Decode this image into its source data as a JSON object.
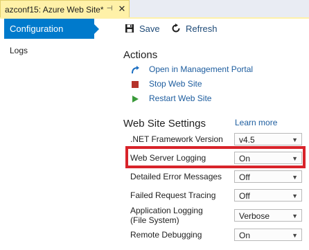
{
  "tab": {
    "title": "azconf15: Azure Web Site*",
    "pin_glyph": "⊣",
    "close_glyph": "✕"
  },
  "nav": {
    "items": [
      {
        "label": "Configuration",
        "active": true
      },
      {
        "label": "Logs",
        "active": false
      }
    ]
  },
  "toolbar": {
    "save_label": "Save",
    "refresh_label": "Refresh"
  },
  "actions": {
    "heading": "Actions",
    "items": [
      {
        "label": "Open in Management Portal",
        "icon": "open-link-icon"
      },
      {
        "label": "Stop Web Site",
        "icon": "stop-icon"
      },
      {
        "label": "Restart Web Site",
        "icon": "play-icon"
      }
    ]
  },
  "settings": {
    "heading": "Web Site Settings",
    "learn_more": "Learn more",
    "rows": [
      {
        "label": ".NET Framework Version",
        "value": "v4.5"
      },
      {
        "label": "Web Server Logging",
        "value": "On"
      },
      {
        "label": "Detailed Error Messages",
        "value": "Off"
      },
      {
        "label": "Failed Request Tracing",
        "value": "Off"
      },
      {
        "label": "Application Logging",
        "label2": "(File System)",
        "value": "Verbose"
      },
      {
        "label": "Remote Debugging",
        "value": "On"
      }
    ]
  },
  "colors": {
    "accent": "#007acc",
    "tab_background": "#fff1a8",
    "link": "#1c5c9e",
    "highlight": "#d8232a",
    "stop": "#c0392b",
    "play": "#3a9a3a"
  }
}
